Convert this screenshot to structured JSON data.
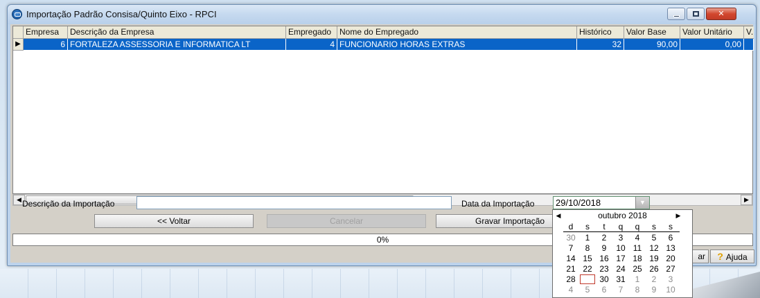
{
  "window": {
    "title": "Importação Padrão Consisa/Quinto Eixo - RPCI",
    "close_glyph": "✕"
  },
  "grid": {
    "columns": [
      "Empresa",
      "Descrição da Empresa",
      "Empregado",
      "Nome do Empregado",
      "Histórico",
      "Valor Base",
      "Valor Unitário",
      "V."
    ],
    "row": {
      "indicator": "▶",
      "empresa": "6",
      "descricao": "FORTALEZA ASSESSORIA E INFORMATICA LT",
      "empregado": "4",
      "nome": "FUNCIONARIO HORAS EXTRAS",
      "historico": "32",
      "valor_base": "90,00",
      "valor_unitario": "0,00"
    }
  },
  "scroll": {
    "left_arrow": "◀",
    "right_arrow": "▶"
  },
  "form": {
    "descricao_label": "Descrição da Importação",
    "descricao_value": "",
    "data_label": "Data da Importação",
    "data_value": "29/10/2018",
    "dropdown_glyph": "▼"
  },
  "buttons": {
    "voltar": "<< Voltar",
    "cancelar": "Cancelar",
    "gravar": "Gravar Importação",
    "partial_left": "ar",
    "ajuda": "Ajuda"
  },
  "progress": {
    "text": "0%",
    "value": 0
  },
  "calendar": {
    "prev": "◀",
    "next": "▶",
    "month": "outubro 2018",
    "weekdays": [
      "d",
      "s",
      "t",
      "q",
      "q",
      "s",
      "s"
    ],
    "weeks": [
      [
        "30",
        "1",
        "2",
        "3",
        "4",
        "5",
        "6"
      ],
      [
        "7",
        "8",
        "9",
        "10",
        "11",
        "12",
        "13"
      ],
      [
        "14",
        "15",
        "16",
        "17",
        "18",
        "19",
        "20"
      ],
      [
        "21",
        "22",
        "23",
        "24",
        "25",
        "26",
        "27"
      ],
      [
        "28",
        "",
        "30",
        "31",
        "1",
        "2",
        "3"
      ],
      [
        "4",
        "5",
        "6",
        "7",
        "8",
        "9",
        "10"
      ]
    ],
    "today": "29"
  },
  "colors": {
    "selection": "#0a64c8",
    "window_frame": "#bcd3ec",
    "client": "#d4d0c8"
  }
}
